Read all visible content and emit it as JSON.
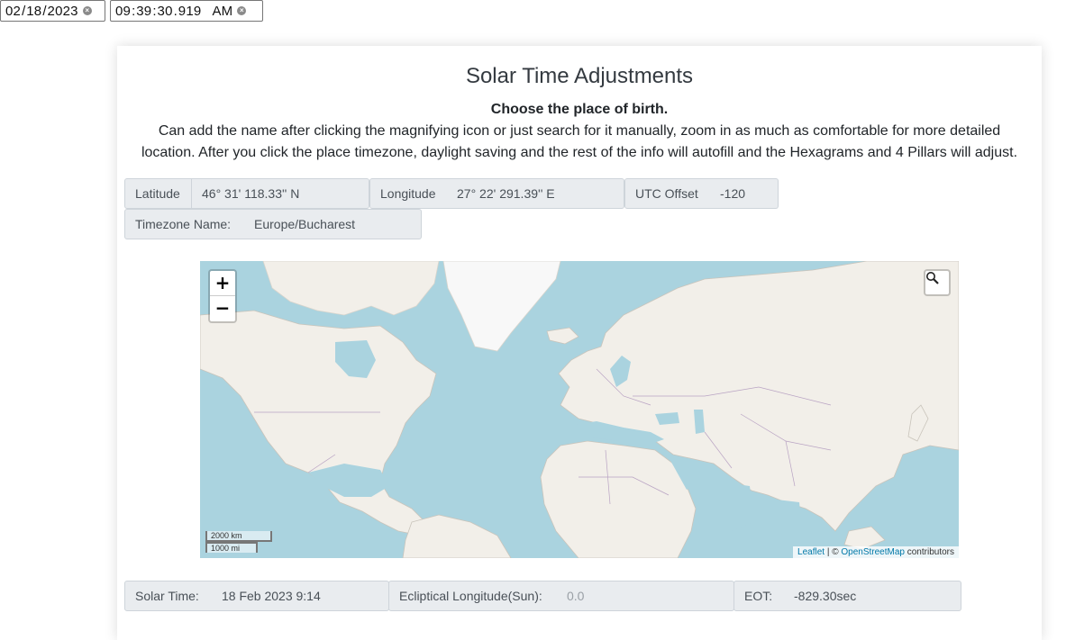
{
  "date_input": {
    "month": "02",
    "day": "18",
    "year": "2023"
  },
  "time_input": {
    "hour": "09",
    "minute": "39",
    "second": "30",
    "ms": "919",
    "ampm": "AM"
  },
  "card": {
    "title": "Solar Time Adjustments",
    "subtitle": "Choose the place of birth.",
    "description": "Can add the name after clicking the magnifying icon or just search for it manually, zoom in as much as comfortable for more detailed location. After you click the place timezone, daylight saving and the rest of the info will autofill and the Hexagrams and 4 Pillars will adjust."
  },
  "location": {
    "latitude_label": "Latitude",
    "latitude_value": "46° 31' 118.33''  N",
    "longitude_label": "Longitude",
    "longitude_value": "27° 22' 291.39''  E",
    "utc_label": "UTC Offset",
    "utc_value": "-120",
    "tz_label": "Timezone Name:",
    "tz_value": "Europe/Bucharest"
  },
  "map": {
    "zoom_in": "+",
    "zoom_out": "−",
    "scale_km": "2000 km",
    "scale_mi": "1000 mi",
    "attribution_leaflet": "Leaflet",
    "attribution_sep": " | © ",
    "attribution_osm": "OpenStreetMap",
    "attribution_suffix": " contributors",
    "colors": {
      "water": "#aad3df",
      "land": "#f2efe9",
      "ice": "#f8f8f8",
      "border": "#b9a3c3"
    }
  },
  "results": {
    "solar_time_label": "Solar Time:",
    "solar_time_value": "18 Feb 2023 9:14",
    "ecliptic_label": "Ecliptical Longitude(Sun):",
    "ecliptic_value": "0.0",
    "eot_label": "EOT:",
    "eot_value": "-829.30sec"
  }
}
